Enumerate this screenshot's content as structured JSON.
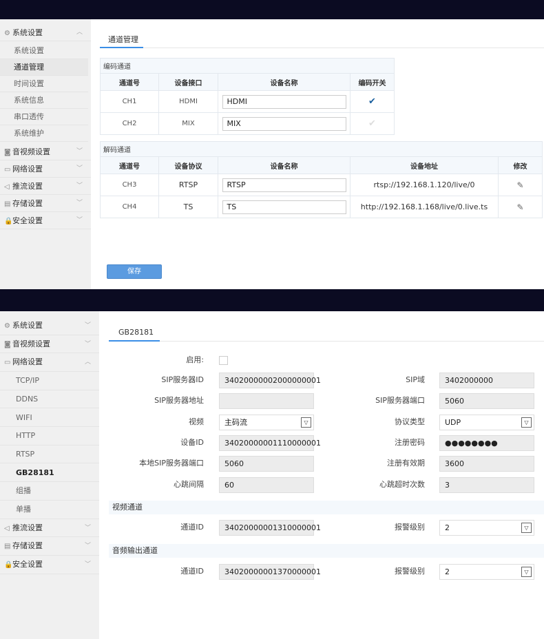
{
  "panel1": {
    "sidebar": {
      "header": "系统设置",
      "subitems": [
        "系统设置",
        "通道管理",
        "时间设置",
        "系统信息",
        "串口透传",
        "系统维护"
      ],
      "active": 1,
      "groups": [
        {
          "label": "音视频设置",
          "icon": "camera-icon"
        },
        {
          "label": "网络设置",
          "icon": "monitor-icon"
        },
        {
          "label": "推流设置",
          "icon": "send-icon"
        },
        {
          "label": "存储设置",
          "icon": "storage-icon"
        },
        {
          "label": "安全设置",
          "icon": "lock-icon"
        }
      ]
    },
    "tab": "通道管理",
    "encode": {
      "caption": "编码通道",
      "headers": [
        "通道号",
        "设备接口",
        "设备名称",
        "编码开关"
      ],
      "rows": [
        {
          "ch": "CH1",
          "iface": "HDMI",
          "name": "HDMI",
          "enabled": true
        },
        {
          "ch": "CH2",
          "iface": "MIX",
          "name": "MIX",
          "enabled": false
        }
      ]
    },
    "decode": {
      "caption": "解码通道",
      "headers": [
        "通道号",
        "设备协议",
        "设备名称",
        "设备地址",
        "修改"
      ],
      "rows": [
        {
          "ch": "CH3",
          "proto": "RTSP",
          "name": "RTSP",
          "addr": "rtsp://192.168.1.120/live/0"
        },
        {
          "ch": "CH4",
          "proto": "TS",
          "name": "TS",
          "addr": "http://192.168.1.168/live/0.live.ts"
        }
      ]
    },
    "save": "保存"
  },
  "panel2": {
    "sidebar": {
      "items": [
        {
          "label": "系统设置",
          "type": "grp",
          "icon": "gear-icon"
        },
        {
          "label": "音视频设置",
          "type": "grp",
          "icon": "camera-icon"
        },
        {
          "label": "网络设置",
          "type": "grp",
          "icon": "monitor-icon",
          "open": true
        },
        {
          "label": "TCP/IP",
          "type": "sub"
        },
        {
          "label": "DDNS",
          "type": "sub"
        },
        {
          "label": "WIFI",
          "type": "sub"
        },
        {
          "label": "HTTP",
          "type": "sub"
        },
        {
          "label": "RTSP",
          "type": "sub"
        },
        {
          "label": "GB28181",
          "type": "sub",
          "active": true
        },
        {
          "label": "组播",
          "type": "sub"
        },
        {
          "label": "单播",
          "type": "sub"
        },
        {
          "label": "推流设置",
          "type": "grp",
          "icon": "send-icon"
        },
        {
          "label": "存储设置",
          "type": "grp",
          "icon": "storage-icon"
        },
        {
          "label": "安全设置",
          "type": "grp",
          "icon": "lock-icon"
        }
      ]
    },
    "tab": "GB28181",
    "enable_label": "启用:",
    "enabled": false,
    "left": [
      {
        "label": "SIP服务器ID",
        "value": "34020000002000000001"
      },
      {
        "label": "SIP服务器地址",
        "value": ""
      },
      {
        "label": "视频",
        "value": "主码流",
        "select": true
      },
      {
        "label": "设备ID",
        "value": "34020000001110000001"
      },
      {
        "label": "本地SIP服务器端口",
        "value": "5060"
      },
      {
        "label": "心跳间隔",
        "value": "60"
      }
    ],
    "right": [
      {
        "label": "SIP域",
        "value": "3402000000"
      },
      {
        "label": "SIP服务器端口",
        "value": "5060"
      },
      {
        "label": "协议类型",
        "value": "UDP",
        "select": true
      },
      {
        "label": "注册密码",
        "value": "●●●●●●●●"
      },
      {
        "label": "注册有效期",
        "value": "3600"
      },
      {
        "label": "心跳超时次数",
        "value": "3"
      }
    ],
    "video_section": "视频通道",
    "video": {
      "label": "通道ID",
      "value": "34020000001310000001",
      "alarm_label": "报警级别",
      "alarm": "2"
    },
    "audio_section": "音频输出通道",
    "audio": {
      "label": "通道ID",
      "value": "34020000001370000001",
      "alarm_label": "报警级别",
      "alarm": "2"
    }
  },
  "colors": {
    "accent": "#3a8ee6",
    "button": "#5b9be0",
    "topbar": "#0b0b22"
  }
}
